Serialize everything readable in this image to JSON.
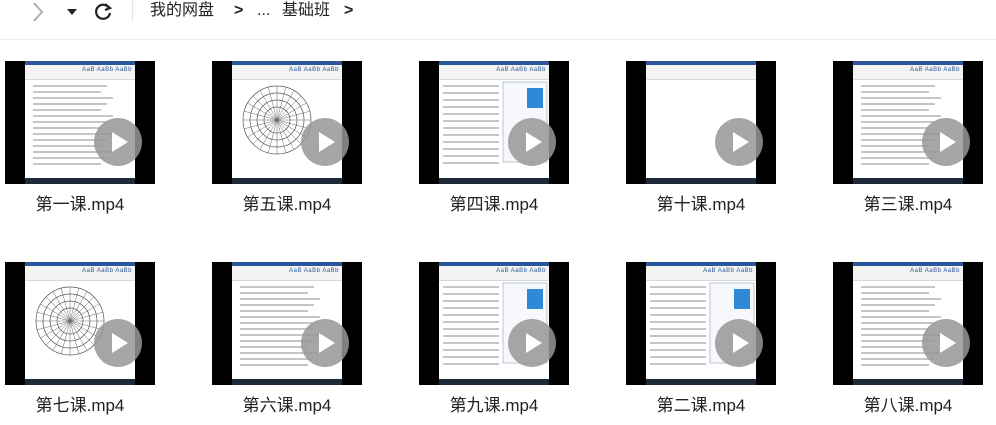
{
  "toolbar": {
    "breadcrumb": [
      "我的网盘",
      "...",
      "基础班"
    ],
    "separator": ">"
  },
  "icons": {
    "forward": "chevron-right-icon",
    "dropdown": "caret-down-icon",
    "refresh": "refresh-icon",
    "play": "play-icon"
  },
  "files": [
    {
      "name": "第一课.mp4",
      "kind": "doc"
    },
    {
      "name": "第五课.mp4",
      "kind": "wheel"
    },
    {
      "name": "第四课.mp4",
      "kind": "chat"
    },
    {
      "name": "第十课.mp4",
      "kind": "blank"
    },
    {
      "name": "第三课.mp4",
      "kind": "doc"
    },
    {
      "name": "第七课.mp4",
      "kind": "wheel"
    },
    {
      "name": "第六课.mp4",
      "kind": "doc"
    },
    {
      "name": "第九课.mp4",
      "kind": "chat"
    },
    {
      "name": "第二课.mp4",
      "kind": "chat"
    },
    {
      "name": "第八课.mp4",
      "kind": "doc"
    }
  ],
  "thumbnail_text": {
    "styles": "AaB AaBb AaBb"
  },
  "colors": {
    "accent": "#2b579a",
    "play": "#969696",
    "mic": "#2e8ad8"
  }
}
